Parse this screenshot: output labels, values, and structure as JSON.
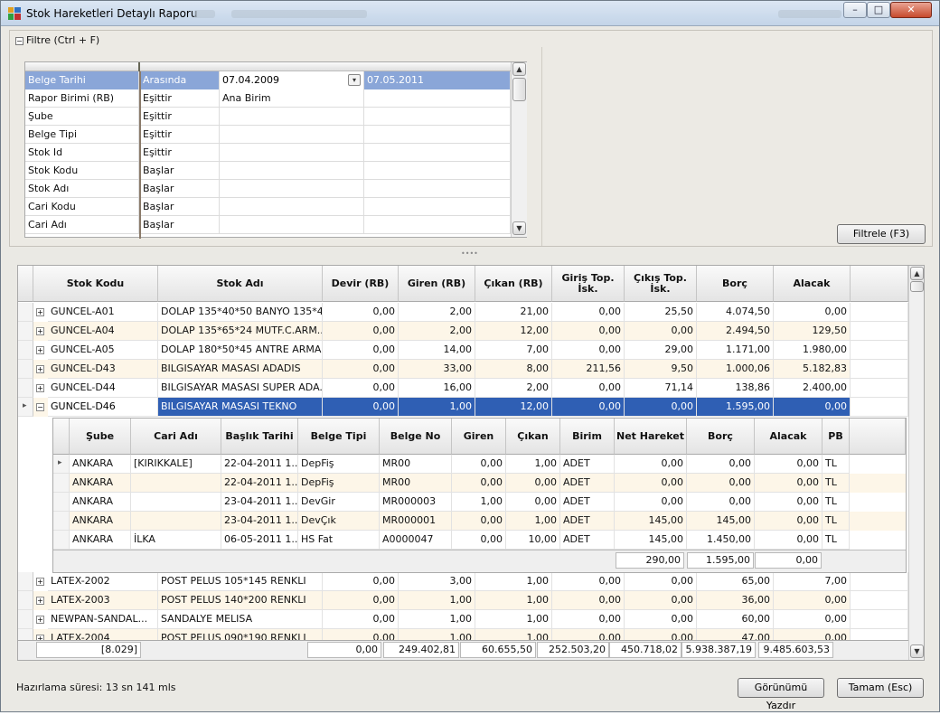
{
  "window": {
    "title": "Stok Hareketleri Detaylı Raporu",
    "min": "–",
    "max": "□",
    "close": "✕"
  },
  "filter": {
    "header": "Filtre (Ctrl + F)",
    "button": "Filtrele (F3)",
    "rows": [
      {
        "field": "Belge Tarihi",
        "op": "Arasında",
        "v1": "07.04.2009",
        "v2": "07.05.2011"
      },
      {
        "field": "Rapor Birimi (RB)",
        "op": "Eşittir",
        "v1": "Ana Birim",
        "v2": ""
      },
      {
        "field": "Şube",
        "op": "Eşittir",
        "v1": "",
        "v2": ""
      },
      {
        "field": "Belge Tipi",
        "op": "Eşittir",
        "v1": "",
        "v2": ""
      },
      {
        "field": "Stok Id",
        "op": "Eşittir",
        "v1": "",
        "v2": ""
      },
      {
        "field": "Stok Kodu",
        "op": "Başlar",
        "v1": "",
        "v2": ""
      },
      {
        "field": "Stok Adı",
        "op": "Başlar",
        "v1": "",
        "v2": ""
      },
      {
        "field": "Cari Kodu",
        "op": "Başlar",
        "v1": "",
        "v2": ""
      },
      {
        "field": "Cari Adı",
        "op": "Başlar",
        "v1": "",
        "v2": ""
      }
    ]
  },
  "grid": {
    "columns": [
      "Stok Kodu",
      "Stok Adı",
      "Devir (RB)",
      "Giren (RB)",
      "Çıkan (RB)",
      "Giriş Top. İsk.",
      "Çıkış Top. İsk.",
      "Borç",
      "Alacak"
    ],
    "rows_top": [
      [
        "GUNCEL-A01",
        "DOLAP 135*40*50 BANYO 135*4...",
        "0,00",
        "2,00",
        "21,00",
        "0,00",
        "25,50",
        "4.074,50",
        "0,00"
      ],
      [
        "GUNCEL-A04",
        "DOLAP 135*65*24 MUTF.C.ARM...",
        "0,00",
        "2,00",
        "12,00",
        "0,00",
        "0,00",
        "2.494,50",
        "129,50"
      ],
      [
        "GUNCEL-A05",
        "DOLAP 180*50*45 ANTRE ARMA...",
        "0,00",
        "14,00",
        "7,00",
        "0,00",
        "29,00",
        "1.171,00",
        "1.980,00"
      ],
      [
        "GUNCEL-D43",
        "BILGISAYAR MASASI ADADIS",
        "0,00",
        "33,00",
        "8,00",
        "211,56",
        "9,50",
        "1.000,06",
        "5.182,83"
      ],
      [
        "GUNCEL-D44",
        "BILGISAYAR MASASI SUPER ADA...",
        "0,00",
        "16,00",
        "2,00",
        "0,00",
        "71,14",
        "138,86",
        "2.400,00"
      ],
      [
        "GUNCEL-D46",
        "BILGISAYAR MASASI TEKNO",
        "0,00",
        "1,00",
        "12,00",
        "0,00",
        "0,00",
        "1.595,00",
        "0,00"
      ]
    ],
    "rows_bottom": [
      [
        "LATEX-2002",
        "POST PELUS 105*145 RENKLI",
        "0,00",
        "3,00",
        "1,00",
        "0,00",
        "0,00",
        "65,00",
        "7,00"
      ],
      [
        "LATEX-2003",
        "POST PELUS 140*200 RENKLI",
        "0,00",
        "1,00",
        "1,00",
        "0,00",
        "0,00",
        "36,00",
        "0,00"
      ],
      [
        "NEWPAN-SANDAL...",
        "SANDALYE MELISA",
        "0,00",
        "1,00",
        "1,00",
        "0,00",
        "0,00",
        "60,00",
        "0,00"
      ],
      [
        "LATEX-2004",
        "POST PELUS 090*190 RENKLI",
        "0,00",
        "1,00",
        "1,00",
        "0,00",
        "0,00",
        "47,00",
        "0,00"
      ]
    ],
    "footer": [
      "[8.029]",
      "0,00",
      "249.402,81",
      "60.655,50",
      "252.503,20",
      "450.718,02",
      "5.938.387,19",
      "9.485.603,53"
    ]
  },
  "detail": {
    "columns": [
      "Şube",
      "Cari Adı",
      "Başlık Tarihi",
      "Belge Tipi",
      "Belge No",
      "Giren",
      "Çıkan",
      "Birim",
      "Net Hareket",
      "Borç",
      "Alacak",
      "PB"
    ],
    "rows": [
      [
        "ANKARA",
        "[KIRIKKALE]",
        "22-04-2011 1...",
        "DepFiş",
        "MR00",
        "0,00",
        "1,00",
        "ADET",
        "0,00",
        "0,00",
        "0,00",
        "TL"
      ],
      [
        "ANKARA",
        "",
        "22-04-2011 1...",
        "DepFiş",
        "MR00",
        "0,00",
        "0,00",
        "ADET",
        "0,00",
        "0,00",
        "0,00",
        "TL"
      ],
      [
        "ANKARA",
        "",
        "23-04-2011 1...",
        "DevGir",
        "MR000003",
        "1,00",
        "0,00",
        "ADET",
        "0,00",
        "0,00",
        "0,00",
        "TL"
      ],
      [
        "ANKARA",
        "",
        "23-04-2011 1...",
        "DevÇık",
        "MR000001",
        "0,00",
        "1,00",
        "ADET",
        "145,00",
        "145,00",
        "0,00",
        "TL"
      ],
      [
        "ANKARA",
        "İLKA",
        "06-05-2011 1...",
        "HS Fat",
        "A0000047",
        "0,00",
        "10,00",
        "ADET",
        "145,00",
        "1.450,00",
        "0,00",
        "TL"
      ]
    ],
    "footer": [
      "290,00",
      "1.595,00",
      "0,00"
    ]
  },
  "status": "Hazırlama süresi: 13 sn 141 mls",
  "buttons": {
    "print": "Görünümü Yazdır",
    "ok": "Tamam (Esc)"
  }
}
